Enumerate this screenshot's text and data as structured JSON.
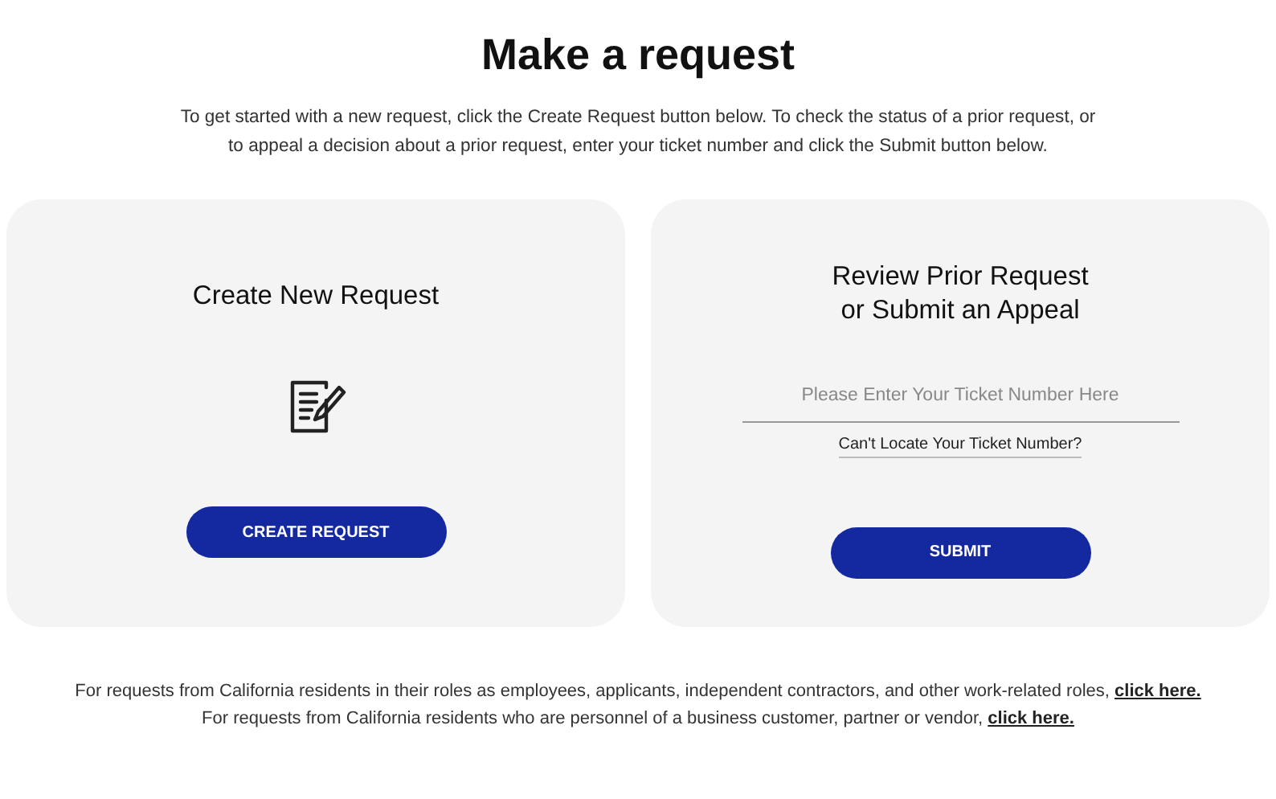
{
  "title": "Make a request",
  "intro": "To get started with a new request, click the Create Request button below. To check the status of a prior request, or to appeal a decision about a prior request, enter your ticket number and click the Submit button below.",
  "create_card": {
    "heading": "Create New Request",
    "button": "CREATE REQUEST"
  },
  "review_card": {
    "heading_lines": [
      "Review Prior Request",
      "or Submit an Appeal"
    ],
    "ticket_field": {
      "placeholder": "Please Enter Your Ticket Number Here"
    },
    "help_link": "Can't Locate Your Ticket Number?",
    "button": "SUBMIT"
  },
  "footer_lines": [
    {
      "text": "For requests from California residents in their roles as employees, applicants, independent contractors, and other work-related roles,",
      "link": "click here."
    },
    {
      "text": "For requests from California residents who are personnel of a business customer, partner or vendor,",
      "link": "click here."
    }
  ]
}
